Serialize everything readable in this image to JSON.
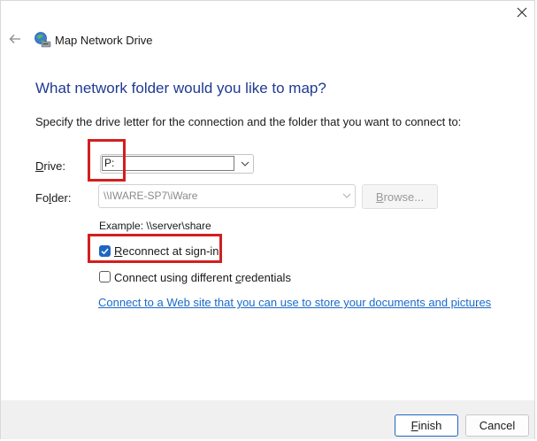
{
  "window": {
    "title": "Map Network Drive",
    "close_icon": "close-icon",
    "back_icon": "back-arrow-icon",
    "app_icon": "network-drive-icon"
  },
  "heading": "What network folder would you like to map?",
  "instruction": "Specify the drive letter for the connection and the folder that you want to connect to:",
  "drive": {
    "label_first": "D",
    "label_rest": "rive:",
    "value": "P:"
  },
  "folder": {
    "label_first": "Fo",
    "label_access": "l",
    "label_rest": "der:",
    "value": "\\\\IWARE-SP7\\iWare",
    "browse_access": "B",
    "browse_rest": "rowse..."
  },
  "example": "Example: \\\\server\\share",
  "reconnect": {
    "access": "R",
    "rest": "econnect at sign-in",
    "checked": true
  },
  "credentials": {
    "before": "Connect using different ",
    "access": "c",
    "after": "redentials",
    "checked": false
  },
  "link": {
    "text": "Connect to a Web site that you can use to store your documents and pictures",
    "suffix": "."
  },
  "buttons": {
    "finish_access": "F",
    "finish_rest": "inish",
    "cancel": "Cancel"
  },
  "colors": {
    "heading": "#1f3a93",
    "link": "#1b6ac9",
    "checkbox_checked": "#1f66c2",
    "highlight": "#d21f1f",
    "footer": "#f0f0f0"
  }
}
